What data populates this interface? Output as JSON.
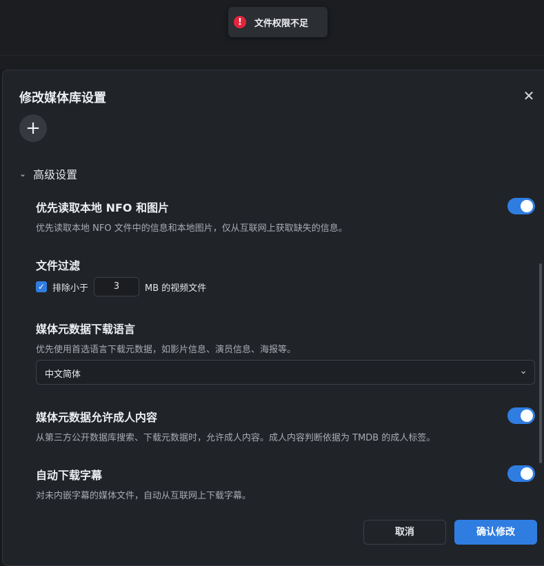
{
  "toast": {
    "message": "文件权限不足",
    "icon": "error-icon",
    "color": "#e5243b"
  },
  "dialog": {
    "title": "修改媒体库设置",
    "close_icon": "close-icon",
    "add_icon": "plus-icon",
    "advanced": {
      "label": "高级设置",
      "expanded": true
    },
    "sections": {
      "nfo": {
        "title": "优先读取本地 NFO 和图片",
        "desc": "优先读取本地 NFO 文件中的信息和本地图片，仅从互联网上获取缺失的信息。",
        "enabled": true
      },
      "filter": {
        "title": "文件过滤",
        "checkbox_label": "排除小于",
        "checked": true,
        "size_value": "3",
        "unit": "MB 的视频文件"
      },
      "language": {
        "title": "媒体元数据下载语言",
        "desc": "优先使用首选语言下载元数据，如影片信息、演员信息、海报等。",
        "selected": "中文简体"
      },
      "adult": {
        "title": "媒体元数据允许成人内容",
        "desc": "从第三方公开数据库搜索、下载元数据时，允许成人内容。成人内容判断依据为 TMDB 的成人标签。",
        "enabled": true
      },
      "subtitle": {
        "title": "自动下载字幕",
        "desc": "对未内嵌字幕的媒体文件，自动从互联网上下载字幕。",
        "enabled": true
      }
    },
    "buttons": {
      "cancel": "取消",
      "confirm": "确认修改"
    },
    "accent_color": "#2f7de1"
  }
}
